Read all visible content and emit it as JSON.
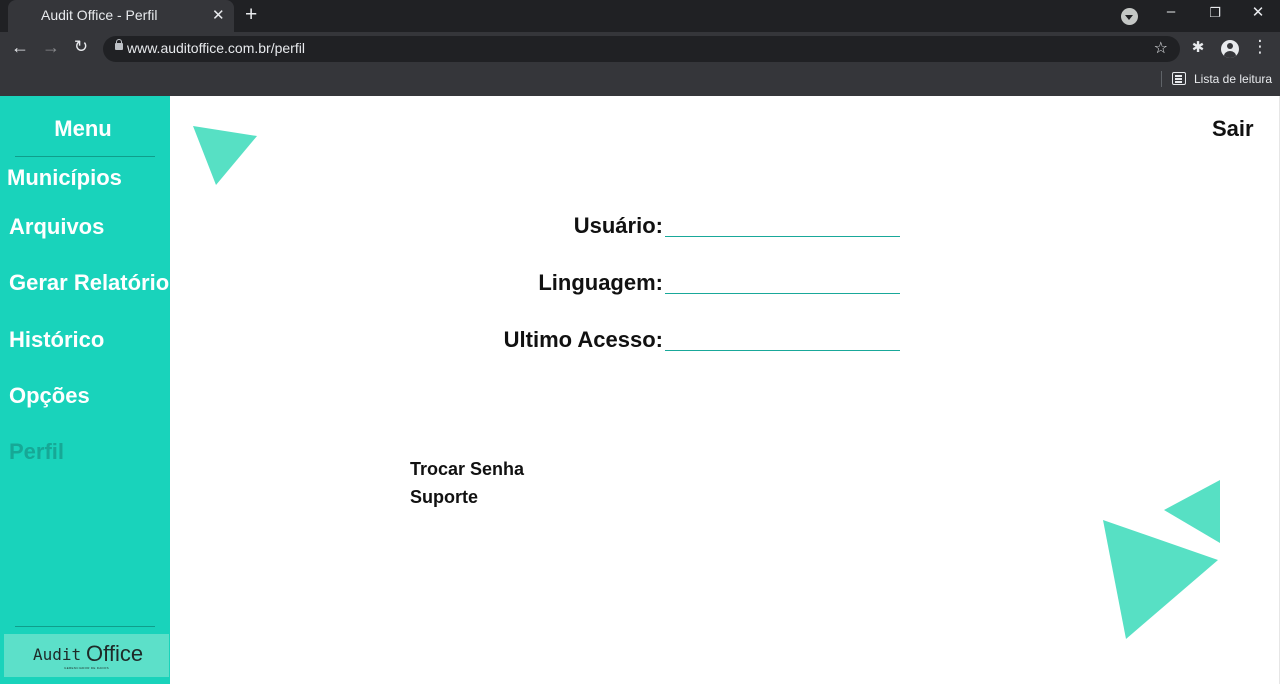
{
  "browser": {
    "tab_title": "Audit Office - Perfil",
    "tab_close_glyph": "✕",
    "new_tab_glyph": "+",
    "url": "www.auditoffice.com.br/perfil",
    "reading_list_label": "Lista de leitura",
    "icons": [
      "tab-search-icon",
      "minimize-icon",
      "restore-icon",
      "close-window-icon",
      "back-icon",
      "forward-icon",
      "reload-icon",
      "lock-icon",
      "star-icon",
      "extensions-icon",
      "profile-icon",
      "more-menu-icon",
      "reading-list-icon"
    ]
  },
  "sidebar": {
    "title": "Menu",
    "items": [
      {
        "label": "Municípios"
      },
      {
        "label": "Arquivos"
      },
      {
        "label": "Gerar Relatório"
      },
      {
        "label": "Histórico"
      },
      {
        "label": "Opções"
      },
      {
        "label": "Perfil",
        "active": true
      }
    ],
    "logo": {
      "audit": "Audit",
      "office": "Office",
      "tagline": "GERENCIADOR DE DADOS"
    }
  },
  "header": {
    "logout_label": "Sair"
  },
  "profile": {
    "fields": [
      {
        "label": "Usuário:",
        "value": ""
      },
      {
        "label": "Linguagem:",
        "value": ""
      },
      {
        "label": "Ultimo Acesso:",
        "value": ""
      }
    ],
    "links": [
      {
        "label": "Trocar Senha"
      },
      {
        "label": "Suporte"
      }
    ]
  },
  "colors": {
    "sidebar": "#19d3bb",
    "accent_triangle": "#57e0c4",
    "active_item": "#16a896",
    "field_line": "#19a89a"
  }
}
